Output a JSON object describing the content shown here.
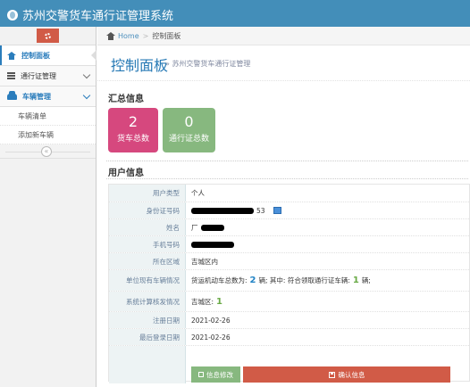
{
  "header": {
    "title": "苏州交警货车通行证管理系统"
  },
  "sidebar": {
    "items": [
      {
        "label": "控制面板"
      },
      {
        "label": "通行证管理"
      },
      {
        "label": "车辆管理"
      }
    ],
    "subitems": [
      {
        "label": "车辆清单"
      },
      {
        "label": "添加新车辆"
      }
    ],
    "collapse_glyph": "«"
  },
  "breadcrumb": {
    "home": "Home",
    "current": "控制面板"
  },
  "page": {
    "title": "控制面板",
    "subtitle": "» 苏州交警货车通行证管理"
  },
  "summary": {
    "heading": "汇总信息",
    "vehicles": {
      "value": "2",
      "label": "货车总数"
    },
    "permits": {
      "value": "0",
      "label": "通行证总数"
    }
  },
  "user": {
    "heading": "用户信息",
    "rows": {
      "type": {
        "label": "用户类型",
        "value": "个人"
      },
      "id": {
        "label": "身份证号码",
        "suffix": "53"
      },
      "name": {
        "label": "姓名",
        "prefix": "厂"
      },
      "phone": {
        "label": "手机号码"
      },
      "area": {
        "label": "所在区域",
        "value": "吉城区内"
      },
      "vehicles": {
        "label": "单位现有车辆情况",
        "p1": "货运机动车总数为:",
        "n1": "2",
        "p2": "辆; 其中: 符合领取通行证车辆:",
        "n2": "1",
        "p3": "辆;"
      },
      "plan": {
        "label": "系统计算核发情况",
        "p1": "吉城区:",
        "n1": "1"
      },
      "reg": {
        "label": "注册日期",
        "value": "2021-02-26"
      },
      "last": {
        "label": "最后登录日期",
        "value": "2021-02-26"
      }
    },
    "edit_button": "信息修改",
    "confirm_button": "确认信息"
  },
  "colors": {
    "header": "#438eb9",
    "pink": "#d6487e",
    "green": "#87b87f",
    "red": "#d15b47",
    "link": "#2b7dbc"
  }
}
